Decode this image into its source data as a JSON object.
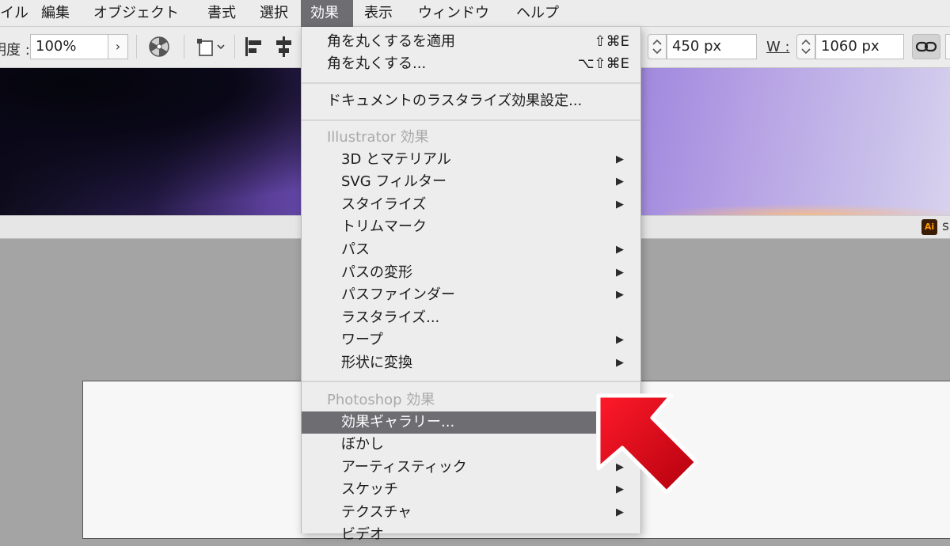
{
  "menubar": {
    "items": [
      {
        "label": "イル"
      },
      {
        "label": "編集"
      },
      {
        "label": "オブジェクト"
      },
      {
        "label": "書式"
      },
      {
        "label": "選択"
      },
      {
        "label": "効果"
      },
      {
        "label": "表示"
      },
      {
        "label": "ウィンドウ"
      },
      {
        "label": "ヘルプ"
      }
    ]
  },
  "controlbar": {
    "opacity_label": "明度 :",
    "opacity_value": "100%",
    "opacity_arrow": "›",
    "h_value": "450 px",
    "w_label": "W :",
    "w_value": "1060 px"
  },
  "statusbar": {
    "tab_letter": "s",
    "file_icon_text": "Ai"
  },
  "dropdown": {
    "top_items": [
      {
        "label": "角を丸くするを適用",
        "shortcut": "⇧⌘E"
      },
      {
        "label": "角を丸くする...",
        "shortcut": "⌥⇧⌘E"
      }
    ],
    "raster_settings": "ドキュメントのラスタライズ効果設定...",
    "illustrator_header": "Illustrator 効果",
    "illustrator_items": [
      {
        "label": "3D とマテリアル",
        "arrow": "▶"
      },
      {
        "label": "SVG フィルター",
        "arrow": "▶"
      },
      {
        "label": "スタイライズ",
        "arrow": "▶"
      },
      {
        "label": "トリムマーク",
        "arrow": ""
      },
      {
        "label": "パス",
        "arrow": "▶"
      },
      {
        "label": "パスの変形",
        "arrow": "▶"
      },
      {
        "label": "パスファインダー",
        "arrow": "▶"
      },
      {
        "label": "ラスタライズ...",
        "arrow": ""
      },
      {
        "label": "ワープ",
        "arrow": "▶"
      },
      {
        "label": "形状に変換",
        "arrow": "▶"
      }
    ],
    "photoshop_header": "Photoshop 効果",
    "photoshop_items": [
      {
        "label": "効果ギャラリー...",
        "arrow": ""
      },
      {
        "label": "ぼかし",
        "arrow": ""
      },
      {
        "label": "アーティスティック",
        "arrow": "▶"
      },
      {
        "label": "スケッチ",
        "arrow": "▶"
      },
      {
        "label": "テクスチャ",
        "arrow": "▶"
      },
      {
        "label": "ビデオ",
        "arrow": ""
      }
    ]
  },
  "colors": {
    "selection": "#6d6d72",
    "callout_arrow": "#e60012"
  }
}
